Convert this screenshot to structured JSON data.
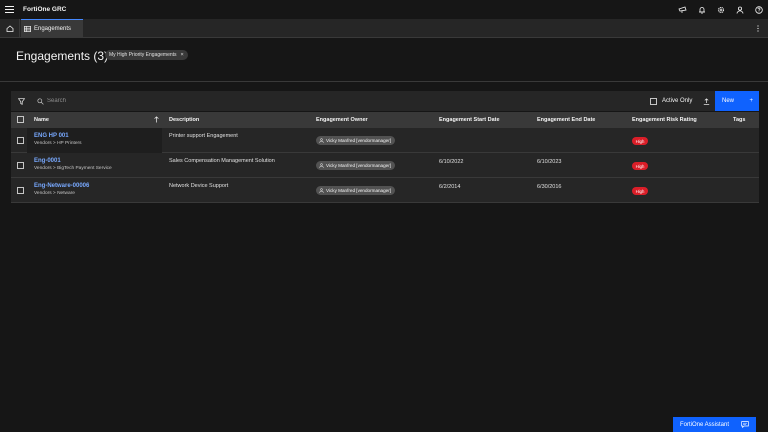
{
  "app": {
    "title": "FortiOne GRC"
  },
  "tabs": {
    "active_label": "Engagements"
  },
  "page": {
    "title": "Engagements (3)",
    "filter_chip": "My High Priority Engagements",
    "filter_chip_close": "×"
  },
  "toolbar": {
    "search_placeholder": "Search",
    "active_only_label": "Active Only",
    "new_label": "New",
    "new_plus": "+"
  },
  "table": {
    "columns": {
      "name": "Name",
      "description": "Description",
      "owner": "Engagement Owner",
      "start": "Engagement Start Date",
      "end": "Engagement End Date",
      "risk": "Engagement Risk Rating",
      "tags": "Tags"
    },
    "rows": [
      {
        "name": "ENG HP 001",
        "path": "Vendors > HP Printers",
        "description": "Printer support Engagement",
        "owner": "Vicky Manfred [vendormanager]",
        "start": "",
        "end": "",
        "risk": "High"
      },
      {
        "name": "Eng-0001",
        "path": "Vendors > BigTech Payment Service",
        "description": "Sales Compensation Management Solution",
        "owner": "Vicky Manfred [vendormanager]",
        "start": "6/10/2022",
        "end": "6/10/2023",
        "risk": "High"
      },
      {
        "name": "Eng-Netware-00006",
        "path": "Vendors > Netware",
        "description": "Network Device Support",
        "owner": "Vicky Manfred [vendormanager]",
        "start": "6/2/2014",
        "end": "6/30/2016",
        "risk": "High"
      }
    ]
  },
  "assistant": {
    "label": "FortiOne Assistant"
  },
  "colors": {
    "accent": "#0f62fe",
    "link": "#78a9ff",
    "risk_high": "#da1e28",
    "background": "#161616",
    "surface": "#262626"
  },
  "icons": [
    "menu-icon",
    "pin-icon",
    "bell-icon",
    "gear-icon",
    "user-icon",
    "help-icon",
    "home-icon",
    "table-icon",
    "kebab-icon",
    "filter-icon",
    "search-icon",
    "upload-icon",
    "plus-icon",
    "sort-arrow-icon",
    "user-icon",
    "chat-icon"
  ]
}
